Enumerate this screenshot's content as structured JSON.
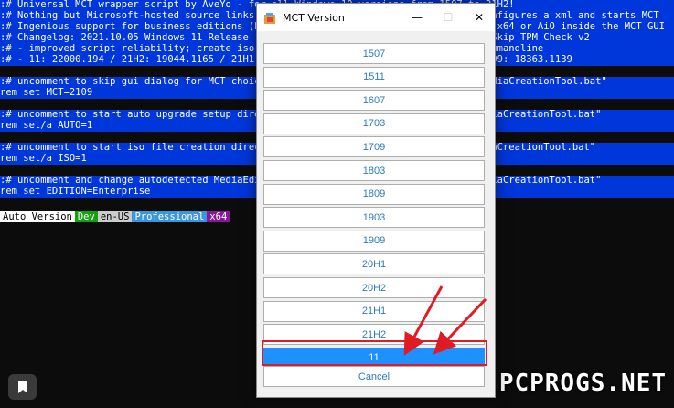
{
  "console": {
    "lines": [
      ":# Universal MCT wrapper script by AveYo - for all Windows 10 versions from 1507 to 21H2!",
      ":# Nothing but Microsoft-hosted source links and no third-party tools; script just configures a xml and starts MCT",
      ":# Ingenious support for business editions (Enterprise / VL) selecting language, x86, x64 or AiO inside the MCT GUI",
      ":# Changelog: 2021.10.05 Windows 11 Release                                   links; Skip TPM Check v2",
      ":# - improved script reliability; create iso                            nt name or commandline",
      ":# - 11: 22000.194 / 21H2: 19044.1165 / 21H1:                               .572 / 1909: 18363.1139",
      "",
      ":# uncomment to skip gui dialog for MCT choice                                21H2 MediaCreationTool.bat\"",
      "rem set MCT=2109",
      "",
      ":# uncomment to start auto upgrade setup direc                               auto MediaCreationTool.bat\"",
      "rem set/a AUTO=1",
      "",
      ":# uncomment to start iso file creation direct                              o 11 MediaCreationTool.bat\"",
      "rem set/a ISO=1",
      "",
      ":# uncomment and change autodetected MediaEdit                               2009 MediaCreationTool.bat\"",
      "rem set EDITION=Enterprise"
    ],
    "status_segments": [
      {
        "text": "Auto Version",
        "bg": "#ffffff",
        "fg": "#000000"
      },
      {
        "text": "Dev",
        "bg": "#13a10e",
        "fg": "#ffffff"
      },
      {
        "text": "en-US",
        "bg": "#cccccc",
        "fg": "#000000"
      },
      {
        "text": "Professional",
        "bg": "#3a96dd",
        "fg": "#ffffff"
      },
      {
        "text": "x64",
        "bg": "#881798",
        "fg": "#ffffff"
      }
    ]
  },
  "dialog": {
    "title": "MCT Version",
    "minimize": "—",
    "maximize": "☐",
    "close": "✕",
    "options": [
      "1507",
      "1511",
      "1607",
      "1703",
      "1709",
      "1803",
      "1809",
      "1903",
      "1909",
      "20H1",
      "20H2",
      "21H1",
      "21H2",
      "11"
    ],
    "selected": "11",
    "cancel": "Cancel"
  },
  "watermark": "PCPROGS.NET",
  "colors": {
    "console_bg": "#0c0c0c",
    "band": "#0037da",
    "accent": "#1e90ff",
    "highlight": "#e01b24"
  },
  "icons": {
    "pin": "pin-icon",
    "app": "app-icon"
  }
}
